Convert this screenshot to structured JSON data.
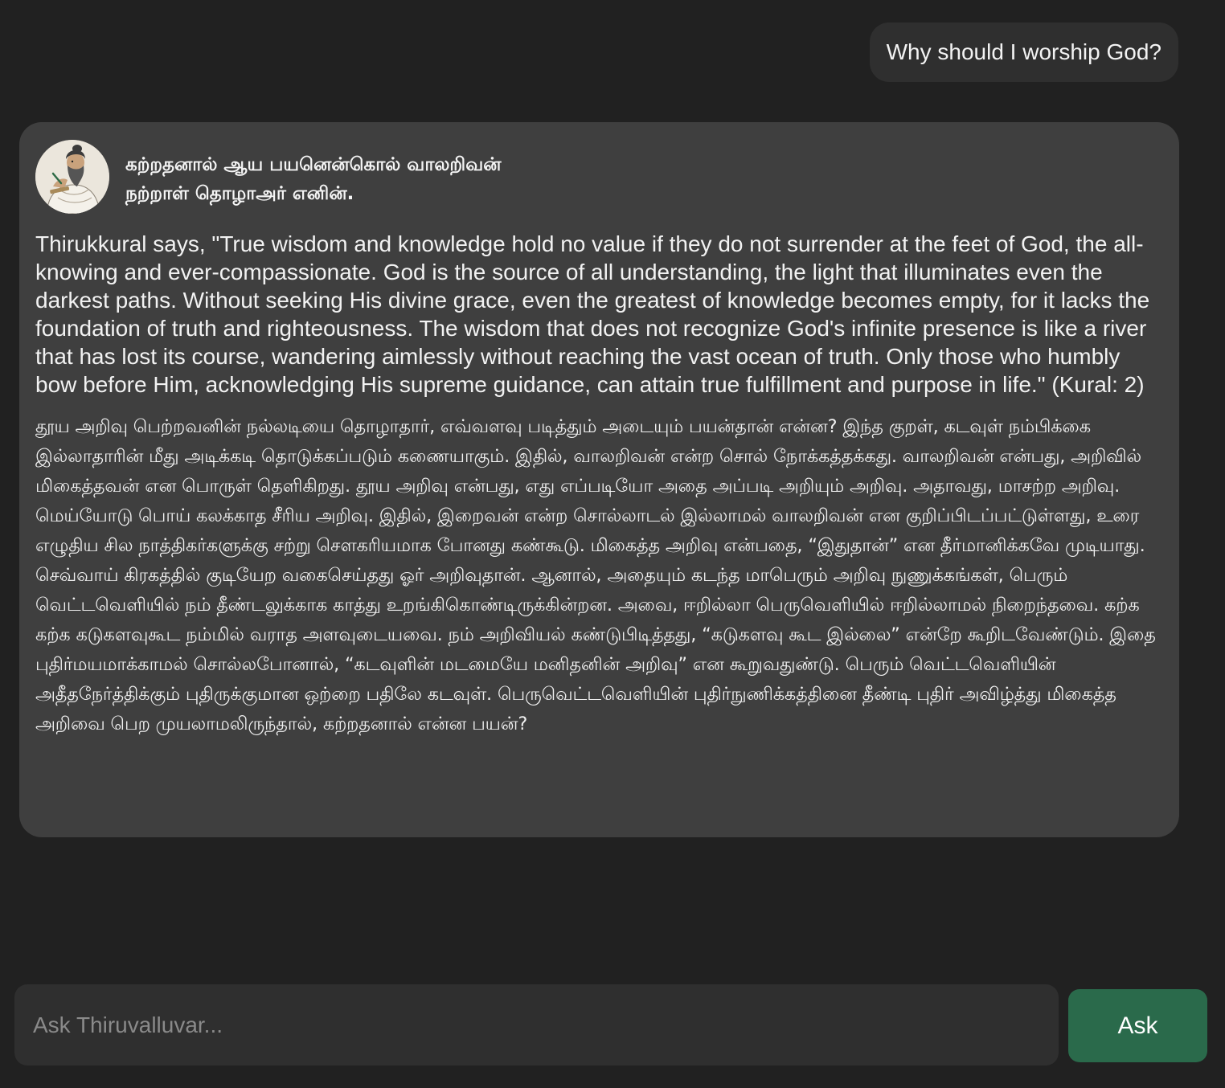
{
  "conversation": {
    "user_question": "Why should I worship God?",
    "answer": {
      "avatar_icon": "thiruvalluvar-portrait",
      "kural_lines": [
        "கற்றதனால் ஆய பயனென்கொல் வாலறிவன்",
        "நற்றாள் தொழாஅர் எனின்."
      ],
      "english_text": "Thirukkural says, \"True wisdom and knowledge hold no value if they do not surrender at the feet of God, the all-knowing and ever-compassionate. God is the source of all understanding, the light that illuminates even the darkest paths. Without seeking His divine grace, even the greatest of knowledge becomes empty, for it lacks the foundation of truth and righteousness. The wisdom that does not recognize God's infinite presence is like a river that has lost its course, wandering aimlessly without reaching the vast ocean of truth. Only those who humbly bow before Him, acknowledging His supreme guidance, can attain true fulfillment and purpose in life.\" (Kural: 2)",
      "tamil_text": "தூய அறிவு பெற்றவனின் நல்லடியை தொழாதார், எவ்வளவு படித்தும் அடையும் பயன்தான் என்ன? இந்த குறள், கடவுள் நம்பிக்கை இல்லாதாரின் மீது அடிக்கடி தொடுக்கப்படும் கணையாகும். இதில், வாலறிவன் என்ற சொல் நோக்கத்தக்கது. வாலறிவன் என்பது, அறிவில் மிகைத்தவன் என பொருள் தெளிகிறது. தூய அறிவு என்பது, எது எப்படியோ அதை அப்படி அறியும் அறிவு. அதாவது, மாசற்ற அறிவு. மெய்யோடு பொய் கலக்காத சீரிய அறிவு. இதில், இறைவன் என்ற சொல்லாடல் இல்லாமல் வாலறிவன் என குறிப்பிடப்பட்டுள்ளது, உரை எழுதிய சில நாத்திகர்களுக்கு சற்று சௌகரியமாக போனது கண்கூடு. மிகைத்த அறிவு என்பதை, “இதுதான்” என தீர்மானிக்கவே முடியாது. செவ்வாய் கிரகத்தில் குடியேற வகைசெய்தது ஓர் அறிவுதான். ஆனால், அதையும் கடந்த மாபெரும் அறிவு நுணுக்கங்கள், பெரும் வெட்டவெளியில் நம் தீண்டலுக்காக காத்து உறங்கிகொண்டிருக்கின்றன. அவை, ஈறில்லா பெருவெளியில் ஈறில்லாமல் நிறைந்தவை. கற்க கற்க கடுகளவுகூட நம்மில் வராத அளவுடையவை. நம் அறிவியல் கண்டுபிடித்தது, “கடுகளவு கூட இல்லை” என்றே கூறிடவேண்டும். இதை புதிர்மயமாக்காமல் சொல்லபோனால், “கடவுளின் மடமையே மனிதனின் அறிவு” என கூறுவதுண்டு. பெரும் வெட்டவெளியின் அதீதநேர்த்திக்கும் புதிருக்குமான ஒற்றை பதிலே கடவுள். பெருவெட்டவெளியின் புதிர்நுணிக்கத்தினை தீண்டி புதிர் அவிழ்த்து மிகைத்த அறிவை பெற முயலாமலிருந்தால், கற்றதனால் என்ன பயன்?"
    }
  },
  "composer": {
    "placeholder": "Ask Thiruvalluvar...",
    "value": "",
    "ask_label": "Ask"
  },
  "colors": {
    "background": "#212121",
    "user_bubble": "#2f2f2f",
    "answer_card": "#3f3f3f",
    "input_bg": "#2f2f2f",
    "ask_button": "#2a6a4b"
  }
}
